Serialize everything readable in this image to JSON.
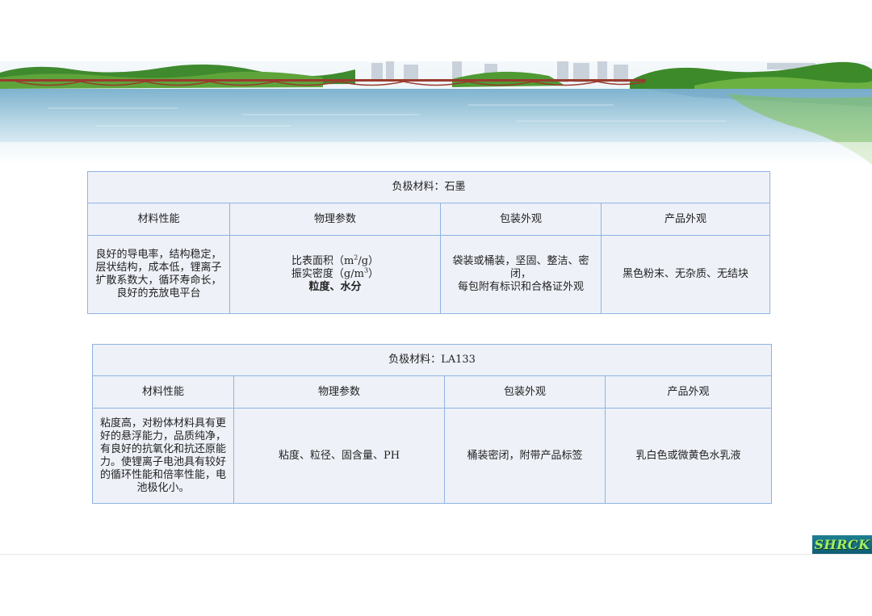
{
  "table1": {
    "title": "负极材料：石墨",
    "headers": [
      "材料性能",
      "物理参数",
      "包装外观",
      "产品外观"
    ],
    "performance": [
      "良好的导电率，结构稳定，",
      "层状结构，成本低，锂离子",
      "扩散系数大，循环寿命长，",
      "良好的充放电平台"
    ],
    "params": {
      "surface_area": "比表面积（m",
      "surface_area_sup": "2",
      "surface_area_unit": "/g）",
      "tap_density": "振实密度（g/m",
      "tap_density_sup": "3",
      "tap_density_unit": "）",
      "other": "粒度、水分"
    },
    "packaging": [
      "袋装或桶装，坚固、整洁、密闭，",
      "每包附有标识和合格证外观"
    ],
    "appearance": "黑色粉末、无杂质、无结块"
  },
  "table2": {
    "title": "负极材料：LA133",
    "headers": [
      "材料性能",
      "物理参数",
      "包装外观",
      "产品外观"
    ],
    "performance": [
      "粘度高，对粉体材料具有更",
      "好的悬浮能力，品质纯净，",
      "有良好的抗氧化和抗还原能",
      "力。使锂离子电池具有较好",
      "的循环性能和倍率性能，电",
      "池极化小。"
    ],
    "params": "粘度、粒径、固含量、PH",
    "packaging": "桶装密闭，附带产品标签",
    "appearance": "乳白色或微黄色水乳液"
  },
  "logo": {
    "text": "SHRCK"
  }
}
